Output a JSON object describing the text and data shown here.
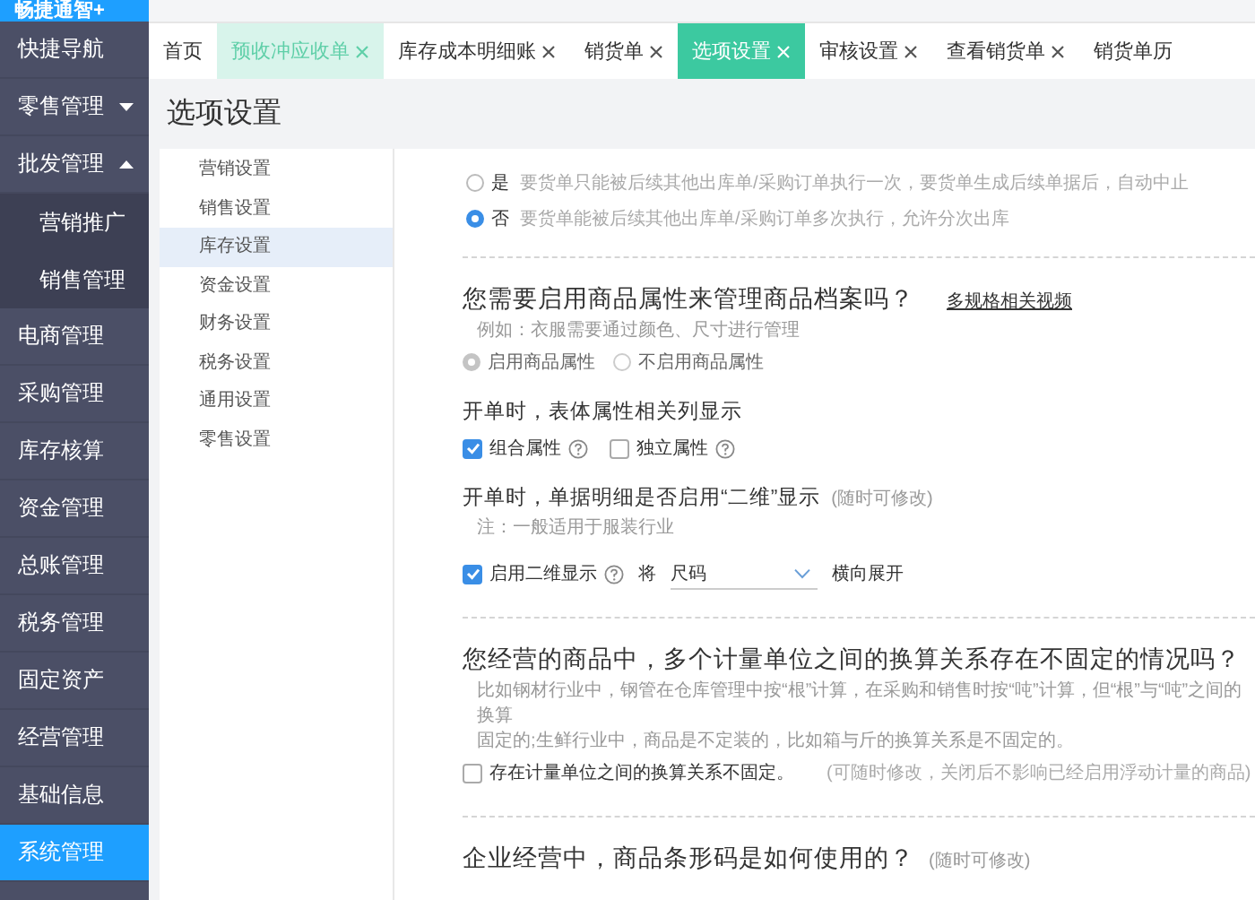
{
  "sidebar": {
    "logo": "畅捷通智+",
    "items": [
      {
        "label": "快捷导航",
        "selected": false
      },
      {
        "label": "零售管理",
        "selected": false,
        "expanded": false
      },
      {
        "label": "批发管理",
        "selected": false,
        "expanded": true,
        "children": [
          {
            "label": "营销推广",
            "selected": false
          },
          {
            "label": "销售管理",
            "selected": false
          }
        ]
      },
      {
        "label": "电商管理",
        "selected": false
      },
      {
        "label": "采购管理",
        "selected": false
      },
      {
        "label": "库存核算",
        "selected": false
      },
      {
        "label": "资金管理",
        "selected": false
      },
      {
        "label": "总账管理",
        "selected": false
      },
      {
        "label": "税务管理",
        "selected": false
      },
      {
        "label": "固定资产",
        "selected": false
      },
      {
        "label": "经营管理",
        "selected": false
      },
      {
        "label": "基础信息",
        "selected": false
      },
      {
        "label": "系统管理",
        "selected": true
      }
    ]
  },
  "tabs": [
    {
      "label": "首页",
      "closable": false,
      "hovered": false,
      "selected": false
    },
    {
      "label": "预收冲应收单",
      "closable": true,
      "hovered": true,
      "selected": false
    },
    {
      "label": "库存成本明细账",
      "closable": true,
      "hovered": false,
      "selected": false
    },
    {
      "label": "销货单",
      "closable": true,
      "hovered": false,
      "selected": false
    },
    {
      "label": "选项设置",
      "closable": true,
      "hovered": false,
      "selected": true
    },
    {
      "label": "审核设置",
      "closable": true,
      "hovered": false,
      "selected": false
    },
    {
      "label": "查看销货单",
      "closable": true,
      "hovered": false,
      "selected": false
    },
    {
      "label": "销货单历",
      "closable": false,
      "hovered": false,
      "selected": false
    }
  ],
  "page_title": "选项设置",
  "settings_nav": [
    {
      "label": "营销设置",
      "selected": false
    },
    {
      "label": "销售设置",
      "selected": false
    },
    {
      "label": "库存设置",
      "selected": true
    },
    {
      "label": "资金设置",
      "selected": false
    },
    {
      "label": "财务设置",
      "selected": false
    },
    {
      "label": "税务设置",
      "selected": false
    },
    {
      "label": "通用设置",
      "selected": false
    },
    {
      "label": "零售设置",
      "selected": false
    }
  ],
  "blocks": [
    {
      "kind": "radio_list",
      "options": [
        {
          "label": "是",
          "note": "要货单只能被后续其他出库单/采购订单执行一次，要货单生成后续单据后，自动中止",
          "selected": false
        },
        {
          "label": "否",
          "note": "要货单能被后续其他出库单/采购订单多次执行，允许分次出库",
          "selected": true
        }
      ]
    },
    {
      "kind": "divider"
    },
    {
      "kind": "heading",
      "text": "您需要启用商品属性来管理商品档案吗？",
      "link": "多规格相关视频"
    },
    {
      "kind": "hint",
      "lines": [
        "例如：衣服需要通过颜色、尺寸进行管理"
      ]
    },
    {
      "kind": "radio_row",
      "disabled": true,
      "options": [
        {
          "label": "启用商品属性",
          "selected": true
        },
        {
          "label": "不启用商品属性",
          "selected": false
        }
      ]
    },
    {
      "kind": "label",
      "text": "开单时，表体属性相关列显示"
    },
    {
      "kind": "checkbox_row",
      "options": [
        {
          "label": "组合属性",
          "checked": true,
          "help": true
        },
        {
          "label": "独立属性",
          "checked": false,
          "help": true
        }
      ]
    },
    {
      "kind": "label",
      "text": "开单时，单据明细是否启用“二维”显示",
      "note": "(随时可修改)"
    },
    {
      "kind": "hint",
      "lines": [
        "注：一般适用于服装行业"
      ]
    },
    {
      "kind": "two_dim_row",
      "checkbox": {
        "label": "启用二维显示",
        "checked": true,
        "help": true
      },
      "prefix": "将",
      "select": "尺码",
      "suffix": "横向展开"
    },
    {
      "kind": "divider"
    },
    {
      "kind": "heading",
      "text": "您经营的商品中，多个计量单位之间的换算关系存在不固定的情况吗？"
    },
    {
      "kind": "hint",
      "lines": [
        "比如钢材行业中，钢管在仓库管理中按“根”计算，在采购和销售时按“吨”计算，但“根”与“吨”之间的换算",
        "固定的;生鲜行业中，商品是不定装的，比如箱与斤的换算关系是不固定的。"
      ]
    },
    {
      "kind": "checkbox_row",
      "options": [
        {
          "label": "存在计量单位之间的换算关系不固定。",
          "checked": false,
          "help": false,
          "note": "(可随时修改，关闭后不影响已经启用浮动计量的商品)"
        }
      ]
    },
    {
      "kind": "divider"
    },
    {
      "kind": "heading",
      "text": "企业经营中，商品条形码是如何使用的？",
      "note": "(随时可修改)"
    }
  ]
}
